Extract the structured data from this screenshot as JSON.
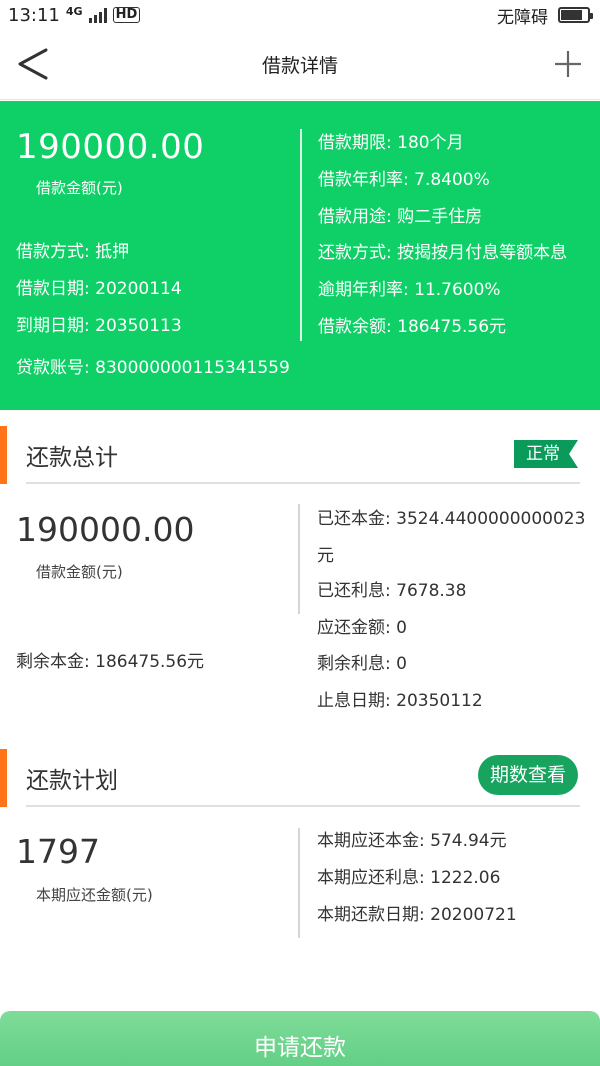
{
  "status_bar": {
    "time": "13:11",
    "network": "4G",
    "hd": "HD",
    "accessibility": "无障碍"
  },
  "nav": {
    "title": "借款详情"
  },
  "loan": {
    "amount": "190000.00",
    "amount_label": "借款金额(元)",
    "method": "借款方式: 抵押",
    "date": "借款日期: 20200114",
    "due_date": "到期日期: 20350113",
    "account": "贷款账号: 830000000115341559",
    "term": "借款期限: 180个月",
    "rate": "借款年利率: 7.8400%",
    "purpose": "借款用途: 购二手住房",
    "repay_method": "还款方式: 按揭按月付息等额本息",
    "overdue_rate": "逾期年利率: 11.7600%",
    "balance": "借款余额: 186475.56元"
  },
  "repay_total": {
    "title": "还款总计",
    "status": "正常",
    "amount": "190000.00",
    "amount_label": "借款金额(元)",
    "remaining_principal": "剩余本金: 186475.56元",
    "paid_principal": "已还本金: 3524.4400000000023",
    "paid_principal_unit": "元",
    "paid_interest": "已还利息: 7678.38",
    "due_amount": "应还金额: 0",
    "remaining_interest": "剩余利息: 0",
    "interest_end_date": "止息日期: 20350112"
  },
  "repay_plan": {
    "title": "还款计划",
    "button": "期数查看",
    "amount": "1797",
    "amount_label": "本期应还金额(元)",
    "principal": "本期应还本金: 574.94元",
    "interest": "本期应还利息: 1222.06",
    "date": "本期还款日期: 20200721"
  },
  "apply_button": "申请还款",
  "colors": {
    "green": "#0ed067",
    "accent_orange": "#ff7418",
    "badge_green": "#0a9a5a"
  }
}
